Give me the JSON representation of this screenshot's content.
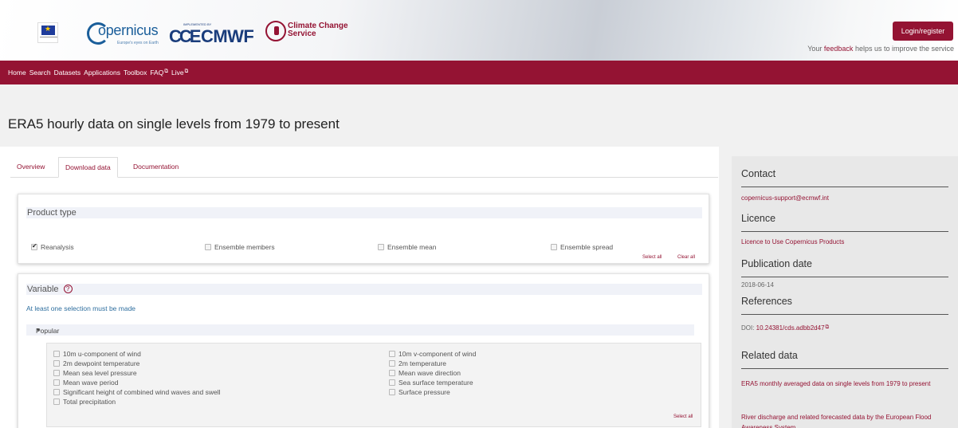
{
  "header": {
    "logos": [
      "eu-flag-icon",
      "copernicus-logo",
      "ecmwf-logo",
      "climate-change-service-logo"
    ],
    "copernicus_word": "opernicus",
    "copernicus_tagline": "Europe's eyes on Earth",
    "ecmwf_small": "IMPLEMENTED BY",
    "ecmwf_word": "ECMWF",
    "c3s_title": "Climate Change Service",
    "login_label": "Login/register",
    "feedback_prefix": "Your ",
    "feedback_link": "feedback",
    "feedback_suffix": " helps us to improve the service"
  },
  "nav": {
    "items": [
      "Home",
      "Search",
      "Datasets",
      "Applications",
      "Toolbox",
      "FAQ",
      "Live"
    ]
  },
  "page": {
    "title": "ERA5 hourly data on single levels from 1979 to present"
  },
  "tabs": [
    "Overview",
    "Download data",
    "Documentation"
  ],
  "product_type": {
    "heading": "Product type",
    "options": [
      {
        "label": "Reanalysis",
        "checked": true
      },
      {
        "label": "Ensemble members",
        "checked": false
      },
      {
        "label": "Ensemble mean",
        "checked": false
      },
      {
        "label": "Ensemble spread",
        "checked": false
      }
    ],
    "select_all": "Select all",
    "clear_all": "Clear all"
  },
  "variable": {
    "heading": "Variable",
    "help_icon": "?",
    "warning": "At least one selection must be made",
    "group": "Popular",
    "left_column": [
      "10m u-component of wind",
      "2m dewpoint temperature",
      "Mean sea level pressure",
      "Mean wave period",
      "Significant height of combined wind waves and swell",
      "Total precipitation"
    ],
    "right_column": [
      "10m v-component of wind",
      "2m temperature",
      "Mean wave direction",
      "Sea surface temperature",
      "Surface pressure"
    ],
    "select_all": "Select all"
  },
  "sidebar": {
    "contact_heading": "Contact",
    "contact_email": "copernicus-support@ecmwf.int",
    "licence_heading": "Licence",
    "licence_link": "Licence to Use Copernicus Products",
    "publication_heading": "Publication date",
    "publication_date": "2018-06-14",
    "references_heading": "References",
    "doi_prefix": "DOI: ",
    "doi_link": "10.24381/cds.adbb2d47",
    "related_heading": "Related data",
    "related_links": [
      "ERA5 monthly averaged data on single levels from 1979 to present",
      "River discharge and related forecasted data by the European Flood Awareness System"
    ]
  },
  "colors": {
    "brand": "#941333",
    "link_blue": "#2f6f9f",
    "ecmwf_blue": "#1a3d7c",
    "copernicus_blue": "#1a5e9a"
  }
}
